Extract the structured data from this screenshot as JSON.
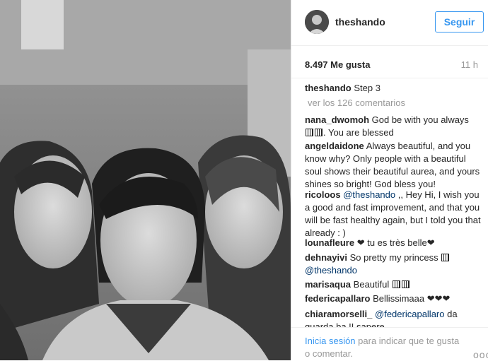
{
  "post": {
    "username": "theshando",
    "follow_label": "Seguir",
    "likes": "8.497 Me gusta",
    "time": "11 h",
    "caption": "Step 3",
    "more_comments": "ver los 126 comentarios"
  },
  "comments": [
    {
      "user": "nana_dwomoh",
      "text": "God be with you always",
      "emoji_after": 2,
      "text2": ". You are blessed"
    },
    {
      "user": "angeldaidone",
      "text": "Always beautiful, and you know why? Only people with a beautiful soul shows their beautiful aurea, and yours shines so bright! God bless you!"
    },
    {
      "user": "ricoloos",
      "mention": "@theshando",
      "text": " ,, Hey Hi, I wish you a good and fast improvement, and that you will be fast healthy again, but I told you that already : )"
    },
    {
      "user": "lounafleure",
      "text": "❤ tu es très belle❤"
    },
    {
      "user": "dehnayivi",
      "text": "So pretty my princess",
      "mention": "@theshando"
    },
    {
      "user": "marisaqua",
      "text": "Beautiful"
    },
    {
      "user": "federicapallaro",
      "text": "Bellissimaaa ❤❤❤"
    },
    {
      "user": "chiaramorselli_",
      "mention": "@federicapallaro",
      "text": " da",
      "text2": "guarda ba !! sapere"
    }
  ],
  "footer": {
    "login_link": "Inicia sesión",
    "login_text": " para indicar que te gusta o comentar.",
    "options": "ooo"
  },
  "colors": {
    "accent": "#3897f0",
    "mention": "#003569",
    "muted": "#999999"
  },
  "icons": [
    "options-icon"
  ]
}
